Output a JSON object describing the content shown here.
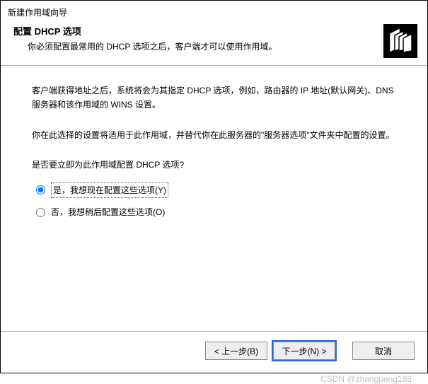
{
  "window": {
    "title": "新建作用域向导"
  },
  "header": {
    "title": "配置 DHCP 选项",
    "subtitle": "你必须配置最常用的 DHCP 选项之后，客户端才可以使用作用域。"
  },
  "content": {
    "para1": "客户端获得地址之后，系统将会为其指定 DHCP 选项，例如，路由器的 IP 地址(默认网关)、DNS 服务器和该作用域的 WINS 设置。",
    "para2": "你在此选择的设置将适用于此作用域，并替代你在此服务器的\"服务器选项\"文件夹中配置的设置。",
    "question": "是否要立即为此作用域配置 DHCP 选项?",
    "radio_yes": "是，我想现在配置这些选项(Y)",
    "radio_no": "否，我想稍后配置这些选项(O)"
  },
  "footer": {
    "back": "< 上一步(B)",
    "next": "下一步(N) >",
    "cancel": "取消"
  },
  "watermark": "CSDN @zhangpeng188"
}
